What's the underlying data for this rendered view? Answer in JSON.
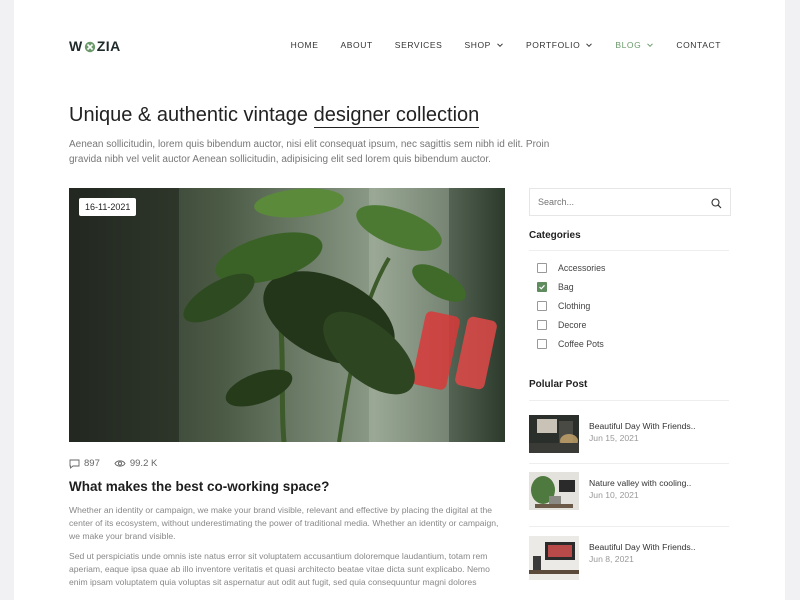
{
  "brand": {
    "logo_text_left": "W",
    "logo_text_right": "ZIA"
  },
  "nav": {
    "items": [
      {
        "label": "HOME"
      },
      {
        "label": "ABOUT"
      },
      {
        "label": "SERVICES"
      },
      {
        "label": "SHOP"
      },
      {
        "label": "PORTFOLIO"
      },
      {
        "label": "BLOG"
      },
      {
        "label": "CONTACT"
      }
    ],
    "active_color": "#6a9a6a"
  },
  "hero": {
    "title_plain": "Unique & authentic vintage",
    "title_highlight": "designer collection",
    "description": "Aenean sollicitudin, lorem quis bibendum auctor, nisi elit consequat ipsum, nec sagittis sem nibh id elit. Proin gravida nibh vel velit auctor Aenean sollicitudin, adipisicing elit sed lorem quis bibendum auctor."
  },
  "post": {
    "date": "16-11-2021",
    "comments": "897",
    "views": "99.2 K",
    "title": "What makes the best co-working space?",
    "paragraph1": "Whether an identity or campaign, we make your brand visible, relevant and effective by placing the digital at the center of its ecosystem, without underestimating the power of traditional media. Whether an identity or campaign, we make your brand visible.",
    "paragraph2": "Sed ut perspiciatis unde omnis iste natus error sit voluptatem accusantium doloremque laudantium, totam rem aperiam, eaque ipsa quae ab illo inventore veritatis et quasi architecto beatae vitae dicta sunt explicabo. Nemo enim ipsam voluptatem quia voluptas sit aspernatur aut odit aut fugit, sed quia consequuntur magni dolores"
  },
  "sidebar": {
    "search_placeholder": "Search...",
    "categories_heading": "Categories",
    "categories": [
      {
        "label": "Accessories",
        "checked": false
      },
      {
        "label": "Bag",
        "checked": true
      },
      {
        "label": "Clothing",
        "checked": false
      },
      {
        "label": "Decore",
        "checked": false
      },
      {
        "label": "Coffee Pots",
        "checked": false
      }
    ],
    "popular_heading": "Polular Post",
    "popular_posts": [
      {
        "title": "Beautiful Day With Friends..",
        "date": "Jun 15, 2021"
      },
      {
        "title": "Nature valley with cooling..",
        "date": "Jun 10, 2021"
      },
      {
        "title": "Beautiful Day With Friends..",
        "date": "Jun 8, 2021"
      }
    ]
  },
  "colors": {
    "accent": "#5f8c5f",
    "text": "#222222",
    "muted": "#888888"
  }
}
